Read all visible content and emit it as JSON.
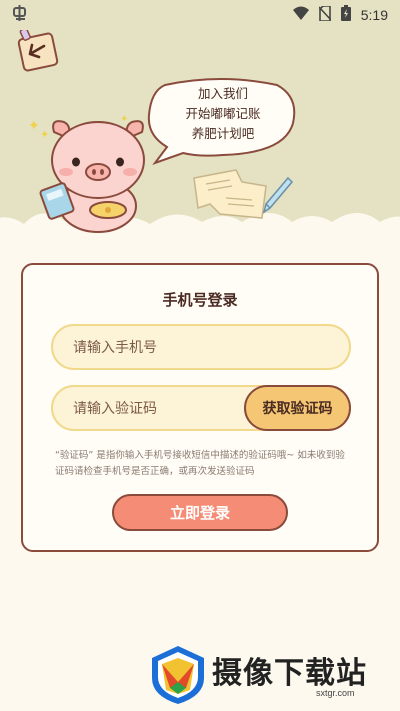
{
  "status_bar": {
    "time": "5:19",
    "left_icon": "app-notification-icon",
    "icons": [
      "wifi-icon",
      "no-sim-icon",
      "battery-icon"
    ]
  },
  "hero": {
    "speech_lines": [
      "加入我们",
      "开始嘟嘟记账",
      "养肥计划吧"
    ],
    "back_icon": "back-arrow-icon"
  },
  "login": {
    "title": "手机号登录",
    "phone_placeholder": "请输入手机号",
    "code_placeholder": "请输入验证码",
    "get_code_label": "获取验证码",
    "hint": "“验证码” 是指你输入手机号接收短信中描述的验证码哦~ 如未收到验证码请检查手机号是否正确，或再次发送验证码",
    "submit_label": "立即登录"
  },
  "watermark": {
    "title": "摄像下载站",
    "url": "sxtgr.com"
  },
  "colors": {
    "background": "#fdf9ee",
    "hero": "#e4e2c2",
    "accent": "#f58d76",
    "field_fill": "#fdf3d6",
    "border": "#8a4a3c",
    "code_button": "#f5c774"
  }
}
